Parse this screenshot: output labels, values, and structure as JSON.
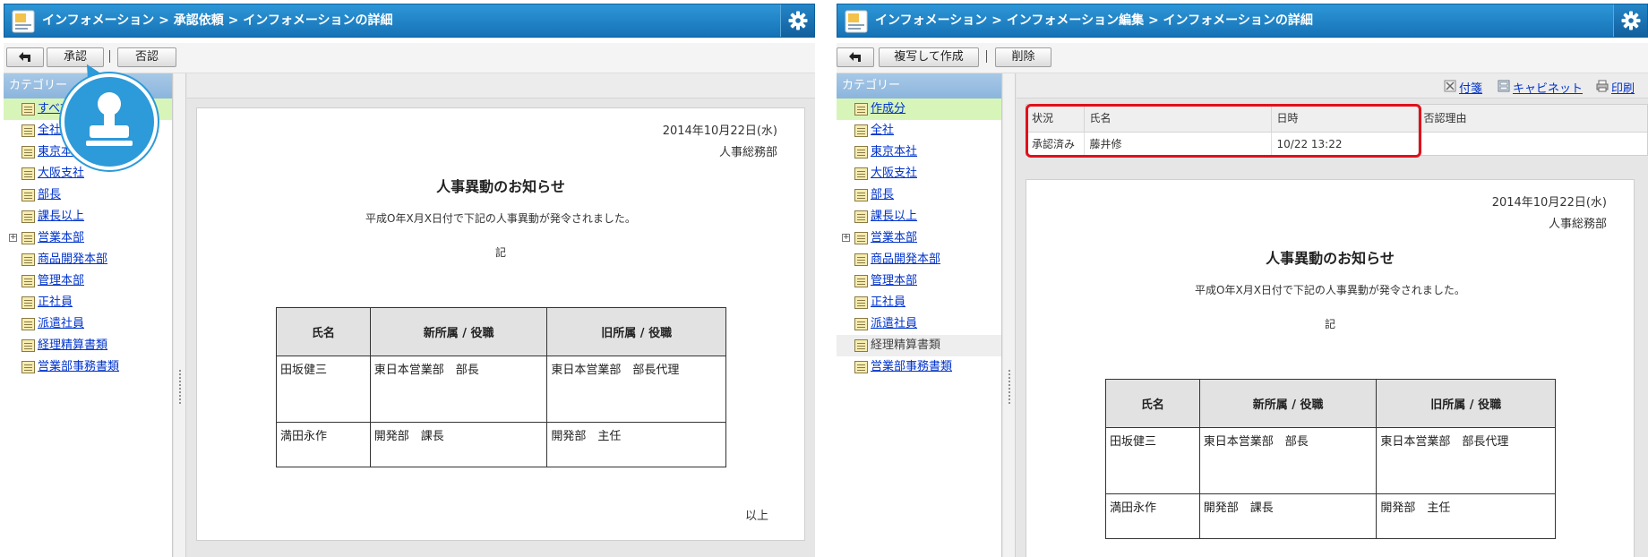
{
  "left": {
    "title": "インフォメーション > 承認依頼 > インフォメーションの詳細",
    "toolbar": {
      "approve_label": "承認",
      "reject_label": "否認"
    },
    "sidebar": {
      "heading": "カテゴリー",
      "items": [
        "すべて",
        "全社",
        "東京本社",
        "大阪支社",
        "部長",
        "課長以上",
        "営業本部",
        "商品開発本部",
        "管理本部",
        "正社員",
        "派遣社員",
        "経理精算書類",
        "営業部事務書類"
      ]
    }
  },
  "right": {
    "title": "インフォメーション > インフォメーション編集 > インフォメーションの詳細",
    "toolbar": {
      "copy_label": "複写して作成",
      "delete_label": "削除"
    },
    "sidebar": {
      "heading": "カテゴリー",
      "items": [
        "作成分",
        "全社",
        "東京本社",
        "大阪支社",
        "部長",
        "課長以上",
        "営業本部",
        "商品開発本部",
        "管理本部",
        "正社員",
        "派遣社員",
        "経理精算書類",
        "営業部事務書類"
      ]
    },
    "links": {
      "attach": "付箋",
      "cabinet": "キャビネット",
      "print": "印刷"
    },
    "status_table": {
      "headers": [
        "状況",
        "氏名",
        "日時",
        "否認理由"
      ],
      "row": [
        "承認済み",
        "藤井修",
        "10/22 13:22",
        ""
      ]
    }
  },
  "document": {
    "date": "2014年10月22日(水)",
    "dept": "人事総務部",
    "title": "人事異動のお知らせ",
    "intro": "平成O年X月X日付で下記の人事異動が発令されました。",
    "ki": "記",
    "closing": "以上",
    "table": {
      "headers": [
        "氏名",
        "新所属 / 役職",
        "旧所属 / 役職"
      ],
      "rows": [
        [
          "田坂健三",
          "東日本営業部　部長",
          "東日本営業部　部長代理"
        ],
        [
          "満田永作",
          "開発部　課長",
          "開発部　主任"
        ]
      ]
    }
  },
  "colors": {
    "titlebar": "#1a7bc0",
    "link": "#0033cc",
    "highlight": "#e0101b",
    "callout": "#2d9ad9",
    "selected": "#d7f5b9"
  }
}
